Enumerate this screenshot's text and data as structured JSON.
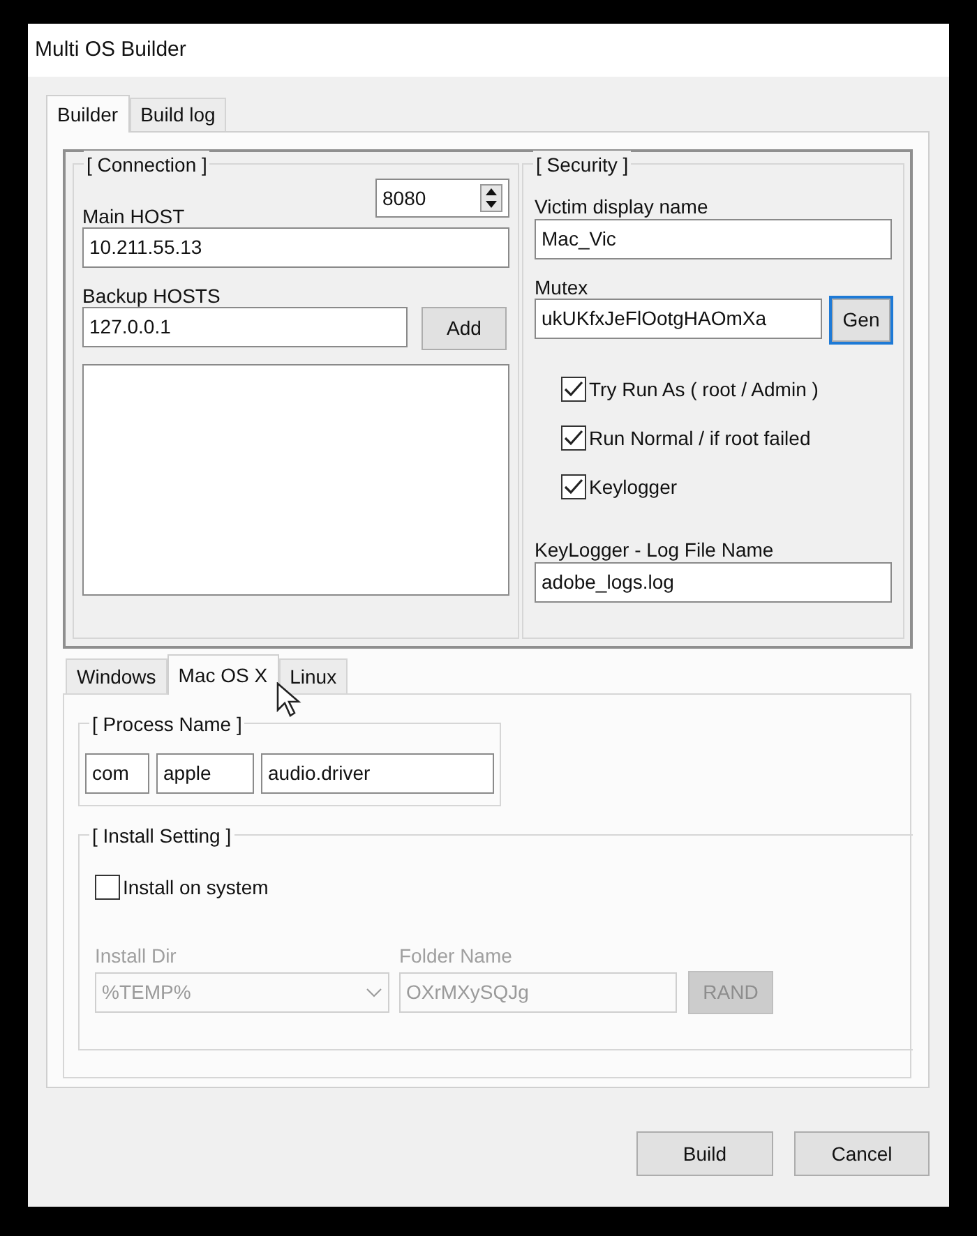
{
  "window": {
    "title": "Multi OS Builder"
  },
  "tabs": [
    {
      "label": "Builder",
      "selected": true
    },
    {
      "label": "Build log",
      "selected": false
    }
  ],
  "connection": {
    "title": "[ Connection ]",
    "port": "8080",
    "main_host_label": "Main HOST",
    "main_host": "10.211.55.13",
    "backup_hosts_label": "Backup HOSTS",
    "backup_host": "127.0.0.1",
    "add_button": "Add"
  },
  "security": {
    "title": "[ Security ]",
    "victim_name_label": "Victim display name",
    "victim_name": "Mac_Vic",
    "mutex_label": "Mutex",
    "mutex": "ukUKfxJeFlOotgHAOmXa",
    "gen_button": "Gen",
    "options": [
      {
        "label": "Try Run As ( root / Admin )",
        "checked": true
      },
      {
        "label": "Run Normal / if root failed",
        "checked": true
      },
      {
        "label": "Keylogger",
        "checked": true
      }
    ],
    "log_file_label": "KeyLogger - Log File Name",
    "log_file": "adobe_logs.log"
  },
  "os_tabs": [
    {
      "label": "Windows",
      "selected": false
    },
    {
      "label": "Mac OS X",
      "selected": true
    },
    {
      "label": "Linux",
      "selected": false
    }
  ],
  "process_name": {
    "title": "[ Process Name ]",
    "parts": [
      "com",
      "apple",
      "audio.driver"
    ]
  },
  "install": {
    "title": "[ Install Setting ]",
    "install_on_system": {
      "label": "Install on system",
      "checked": false
    },
    "install_dir": {
      "label": "Install Dir",
      "value": "%TEMP%",
      "disabled": true
    },
    "folder_name": {
      "label": "Folder Name",
      "value": "OXrMXySQJg",
      "disabled": true
    },
    "rand_button": {
      "label": "RAND",
      "disabled": true
    }
  },
  "buttons": [
    "Build",
    "Cancel"
  ]
}
